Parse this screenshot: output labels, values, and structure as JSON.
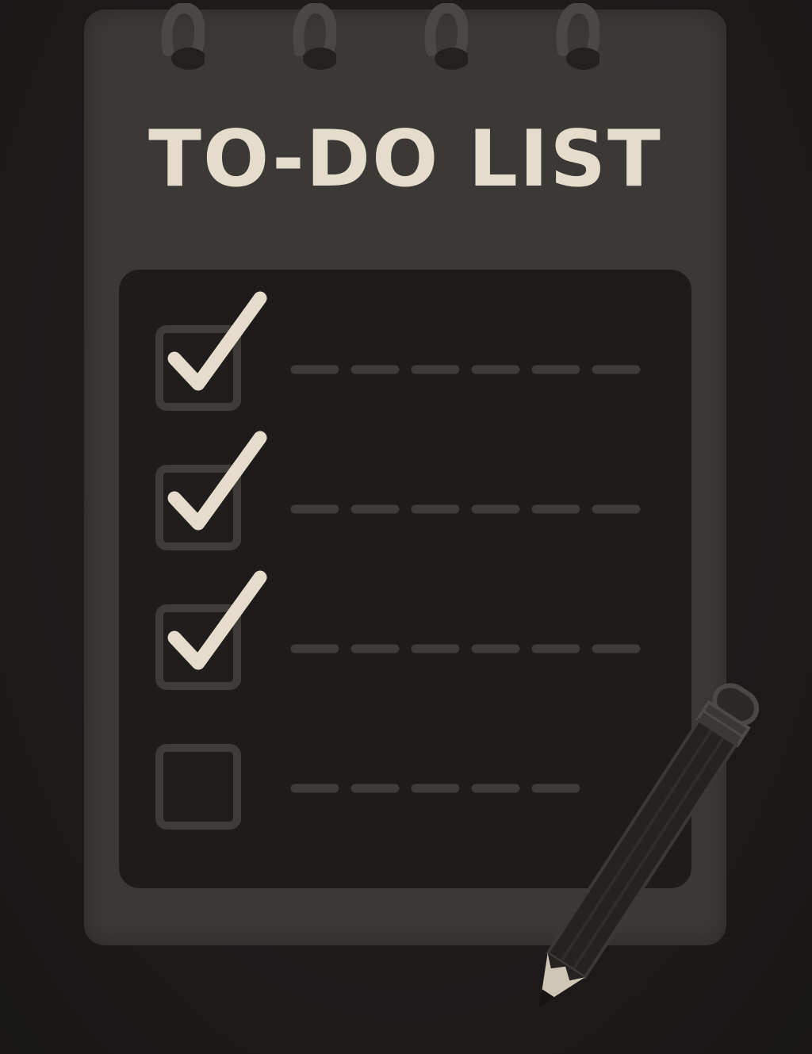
{
  "notepad": {
    "title": "TO-DO LIST",
    "items": [
      {
        "checked": true,
        "dash_count": 6
      },
      {
        "checked": true,
        "dash_count": 6
      },
      {
        "checked": true,
        "dash_count": 6
      },
      {
        "checked": false,
        "dash_count": 5
      }
    ]
  },
  "colors": {
    "background": "#1f1d1c",
    "notepad": "#3b3936",
    "panel": "#1e1c1b",
    "accent_cream": "#e6dccb",
    "line_gray": "#3e3c39"
  },
  "icons": {
    "spiral": "spiral-ring-icon",
    "check": "checkmark-icon",
    "pencil": "pencil-icon"
  }
}
